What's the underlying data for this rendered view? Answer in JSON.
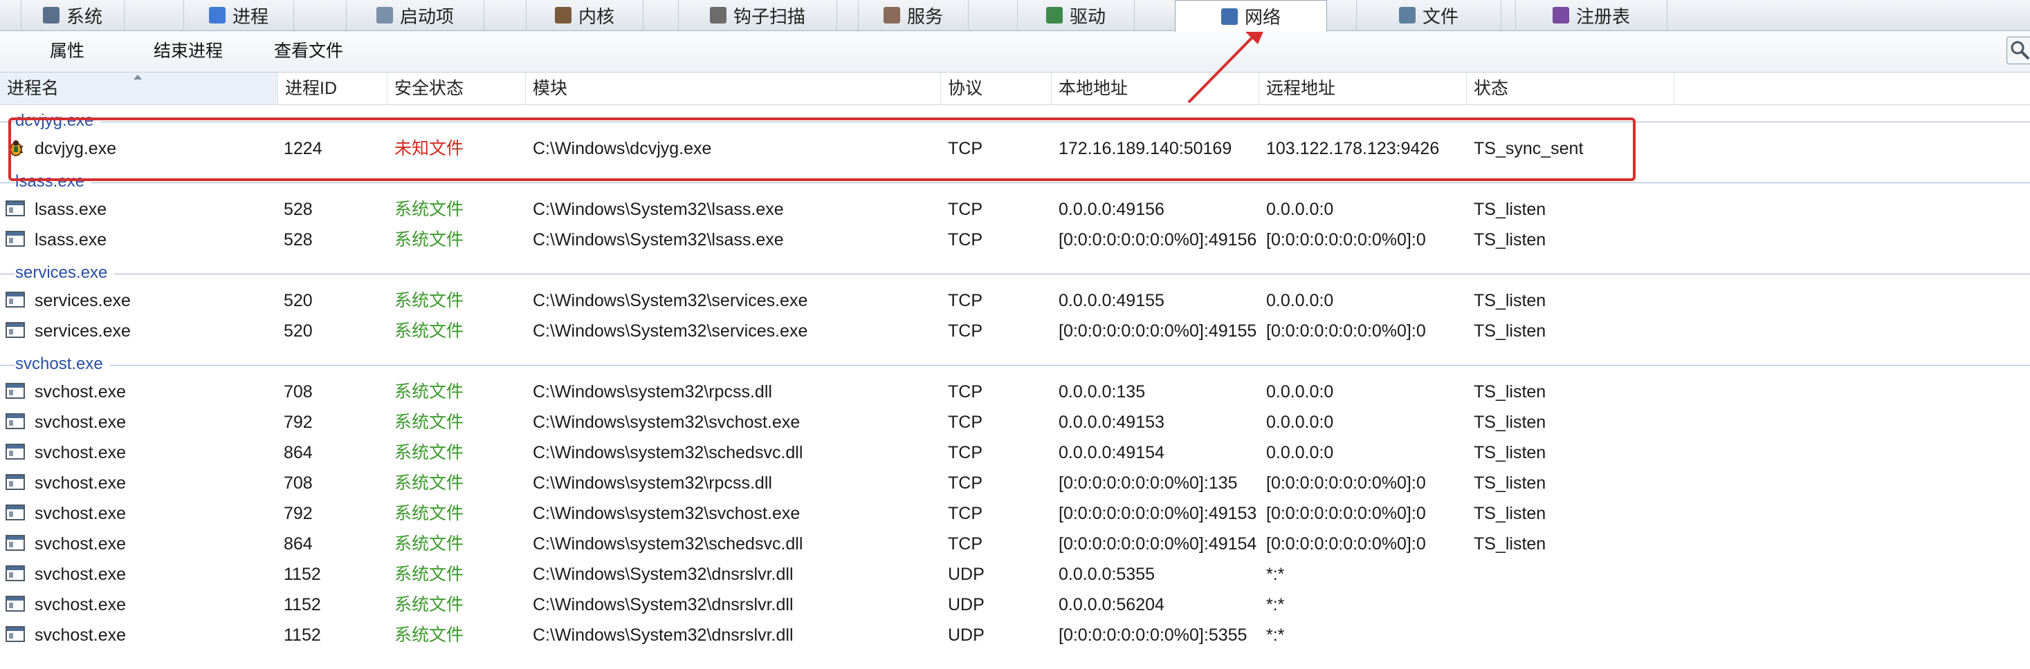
{
  "tabs": [
    {
      "label": "系统",
      "icon": "system-monitor-icon",
      "active": false
    },
    {
      "label": "进程",
      "icon": "windows-flag-icon",
      "active": false
    },
    {
      "label": "启动项",
      "icon": "startup-gear-icon",
      "active": false
    },
    {
      "label": "内核",
      "icon": "kernel-chip-icon",
      "active": false
    },
    {
      "label": "钩子扫描",
      "icon": "hook-scan-icon",
      "active": false
    },
    {
      "label": "服务",
      "icon": "services-tools-icon",
      "active": false
    },
    {
      "label": "驱动",
      "icon": "driver-gear-icon",
      "active": false
    },
    {
      "label": "网络",
      "icon": "network-computers-icon",
      "active": true
    },
    {
      "label": "文件",
      "icon": "file-document-icon",
      "active": false
    },
    {
      "label": "注册表",
      "icon": "registry-cubes-icon",
      "active": false
    }
  ],
  "toolbar": {
    "properties": "属性",
    "end_process": "结束进程",
    "view_file": "查看文件",
    "search_icon": "magnifier-icon"
  },
  "columns": {
    "process_name": "进程名",
    "pid": "进程ID",
    "security": "安全状态",
    "module": "模块",
    "protocol": "协议",
    "local_address": "本地地址",
    "remote_address": "远程地址",
    "state": "状态"
  },
  "groups": [
    {
      "name": "dcvjyg.exe",
      "rows": [
        {
          "icon": "suspicious-bug-icon",
          "process": "dcvjyg.exe",
          "pid": "1224",
          "security": "未知文件",
          "security_level": "unknown",
          "module": "C:\\Windows\\dcvjyg.exe",
          "protocol": "TCP",
          "local": "172.16.189.140:50169",
          "remote": "103.122.178.123:9426",
          "state": "TS_sync_sent"
        }
      ]
    },
    {
      "name": "lsass.exe",
      "rows": [
        {
          "icon": "window-app-icon",
          "process": "lsass.exe",
          "pid": "528",
          "security": "系统文件",
          "security_level": "system",
          "module": "C:\\Windows\\System32\\lsass.exe",
          "protocol": "TCP",
          "local": "0.0.0.0:49156",
          "remote": "0.0.0.0:0",
          "state": "TS_listen"
        },
        {
          "icon": "window-app-icon",
          "process": "lsass.exe",
          "pid": "528",
          "security": "系统文件",
          "security_level": "system",
          "module": "C:\\Windows\\System32\\lsass.exe",
          "protocol": "TCP",
          "local": "[0:0:0:0:0:0:0:0%0]:49156",
          "remote": "[0:0:0:0:0:0:0:0%0]:0",
          "state": "TS_listen"
        }
      ]
    },
    {
      "name": "services.exe",
      "rows": [
        {
          "icon": "window-app-icon",
          "process": "services.exe",
          "pid": "520",
          "security": "系统文件",
          "security_level": "system",
          "module": "C:\\Windows\\System32\\services.exe",
          "protocol": "TCP",
          "local": "0.0.0.0:49155",
          "remote": "0.0.0.0:0",
          "state": "TS_listen"
        },
        {
          "icon": "window-app-icon",
          "process": "services.exe",
          "pid": "520",
          "security": "系统文件",
          "security_level": "system",
          "module": "C:\\Windows\\System32\\services.exe",
          "protocol": "TCP",
          "local": "[0:0:0:0:0:0:0:0%0]:49155",
          "remote": "[0:0:0:0:0:0:0:0%0]:0",
          "state": "TS_listen"
        }
      ]
    },
    {
      "name": "svchost.exe",
      "rows": [
        {
          "icon": "window-app-icon",
          "process": "svchost.exe",
          "pid": "708",
          "security": "系统文件",
          "security_level": "system",
          "module": "C:\\Windows\\system32\\rpcss.dll",
          "protocol": "TCP",
          "local": "0.0.0.0:135",
          "remote": "0.0.0.0:0",
          "state": "TS_listen"
        },
        {
          "icon": "window-app-icon",
          "process": "svchost.exe",
          "pid": "792",
          "security": "系统文件",
          "security_level": "system",
          "module": "C:\\Windows\\system32\\svchost.exe",
          "protocol": "TCP",
          "local": "0.0.0.0:49153",
          "remote": "0.0.0.0:0",
          "state": "TS_listen"
        },
        {
          "icon": "window-app-icon",
          "process": "svchost.exe",
          "pid": "864",
          "security": "系统文件",
          "security_level": "system",
          "module": "C:\\Windows\\system32\\schedsvc.dll",
          "protocol": "TCP",
          "local": "0.0.0.0:49154",
          "remote": "0.0.0.0:0",
          "state": "TS_listen"
        },
        {
          "icon": "window-app-icon",
          "process": "svchost.exe",
          "pid": "708",
          "security": "系统文件",
          "security_level": "system",
          "module": "C:\\Windows\\system32\\rpcss.dll",
          "protocol": "TCP",
          "local": "[0:0:0:0:0:0:0:0%0]:135",
          "remote": "[0:0:0:0:0:0:0:0%0]:0",
          "state": "TS_listen"
        },
        {
          "icon": "window-app-icon",
          "process": "svchost.exe",
          "pid": "792",
          "security": "系统文件",
          "security_level": "system",
          "module": "C:\\Windows\\system32\\svchost.exe",
          "protocol": "TCP",
          "local": "[0:0:0:0:0:0:0:0%0]:49153",
          "remote": "[0:0:0:0:0:0:0:0%0]:0",
          "state": "TS_listen"
        },
        {
          "icon": "window-app-icon",
          "process": "svchost.exe",
          "pid": "864",
          "security": "系统文件",
          "security_level": "system",
          "module": "C:\\Windows\\system32\\schedsvc.dll",
          "protocol": "TCP",
          "local": "[0:0:0:0:0:0:0:0%0]:49154",
          "remote": "[0:0:0:0:0:0:0:0%0]:0",
          "state": "TS_listen"
        },
        {
          "icon": "window-app-icon",
          "process": "svchost.exe",
          "pid": "1152",
          "security": "系统文件",
          "security_level": "system",
          "module": "C:\\Windows\\System32\\dnsrslvr.dll",
          "protocol": "UDP",
          "local": "0.0.0.0:5355",
          "remote": "*:*",
          "state": ""
        },
        {
          "icon": "window-app-icon",
          "process": "svchost.exe",
          "pid": "1152",
          "security": "系统文件",
          "security_level": "system",
          "module": "C:\\Windows\\System32\\dnsrslvr.dll",
          "protocol": "UDP",
          "local": "0.0.0.0:56204",
          "remote": "*:*",
          "state": ""
        },
        {
          "icon": "window-app-icon",
          "process": "svchost.exe",
          "pid": "1152",
          "security": "系统文件",
          "security_level": "system",
          "module": "C:\\Windows\\System32\\dnsrslvr.dll",
          "protocol": "UDP",
          "local": "[0:0:0:0:0:0:0:0%0]:5355",
          "remote": "*:*",
          "state": ""
        }
      ]
    }
  ],
  "annotation": {
    "color": "#d72f2f",
    "highlighted_group": "dcvjyg.exe",
    "arrow_target_tab": "网络"
  },
  "colors": {
    "system_file": "#3d9a2d",
    "unknown_file": "#d22a20",
    "group_label": "#2a4fa0"
  }
}
